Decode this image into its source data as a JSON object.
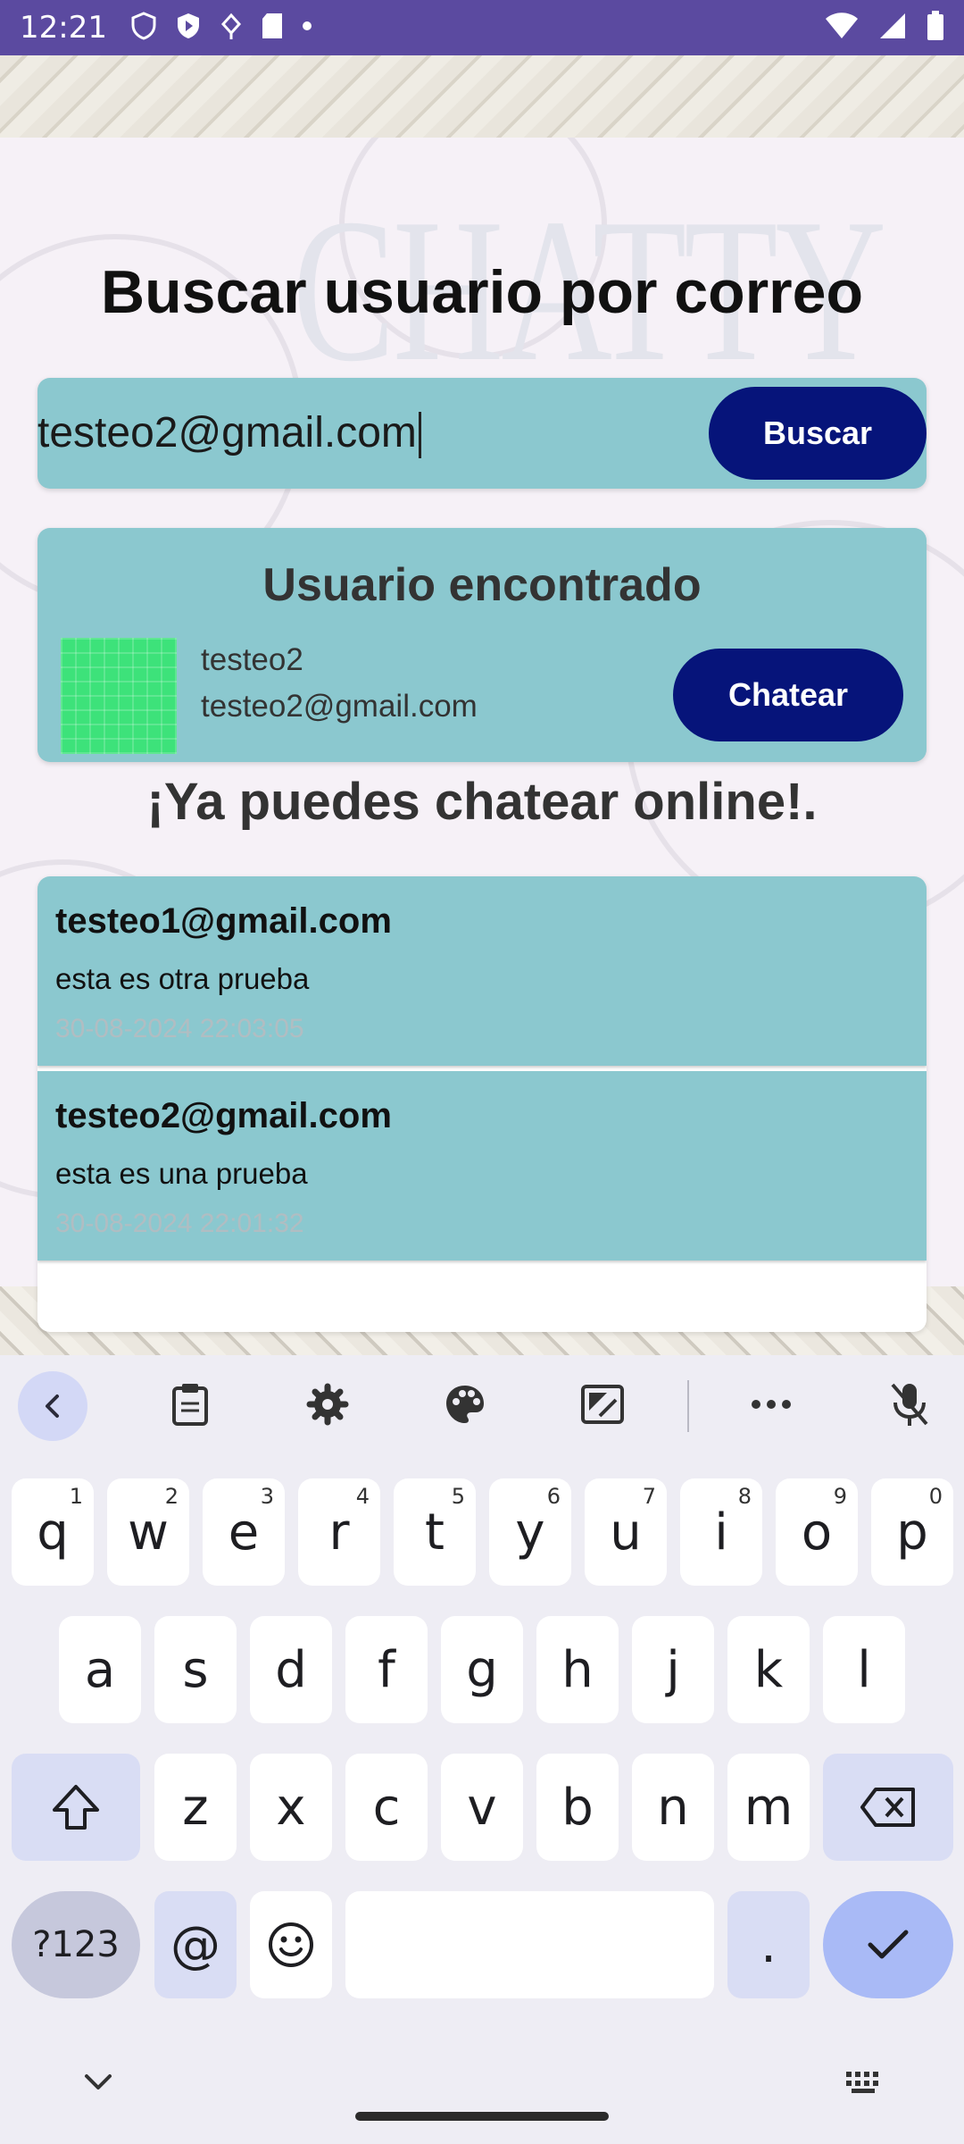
{
  "status_bar": {
    "time": "12:21"
  },
  "app": {
    "logo_text": "CHATTY",
    "title": "Buscar usuario por correo",
    "search": {
      "value": "testeo2@gmail.com",
      "button_label": "Buscar"
    },
    "found_user": {
      "heading": "Usuario encontrado",
      "name": "testeo2",
      "email": "testeo2@gmail.com",
      "chat_button_label": "Chatear",
      "avatar_color": "#3de27a"
    },
    "online_message": "¡Ya puedes chatear online!.",
    "chats": [
      {
        "email": "testeo1@gmail.com",
        "message": "esta es otra prueba",
        "timestamp": "30-08-2024 22:03:05"
      },
      {
        "email": "testeo2@gmail.com",
        "message": "esta es una prueba",
        "timestamp": "30-08-2024 22:01:32"
      }
    ]
  },
  "keyboard": {
    "toolbar_icons": [
      "back-icon",
      "clipboard-icon",
      "settings-icon",
      "palette-icon",
      "resize-icon",
      "more-icon",
      "mic-off-icon"
    ],
    "row1": [
      {
        "key": "q",
        "hint": "1"
      },
      {
        "key": "w",
        "hint": "2"
      },
      {
        "key": "e",
        "hint": "3"
      },
      {
        "key": "r",
        "hint": "4"
      },
      {
        "key": "t",
        "hint": "5"
      },
      {
        "key": "y",
        "hint": "6"
      },
      {
        "key": "u",
        "hint": "7"
      },
      {
        "key": "i",
        "hint": "8"
      },
      {
        "key": "o",
        "hint": "9"
      },
      {
        "key": "p",
        "hint": "0"
      }
    ],
    "row2": [
      "a",
      "s",
      "d",
      "f",
      "g",
      "h",
      "j",
      "k",
      "l"
    ],
    "row3": [
      "z",
      "x",
      "c",
      "v",
      "b",
      "n",
      "m"
    ],
    "symbols_label": "?123",
    "at_label": "@",
    "period_label": ".",
    "colors": {
      "accent": "#06147a",
      "card": "#8bc8cf",
      "status_bar": "#5b4aa0"
    }
  }
}
